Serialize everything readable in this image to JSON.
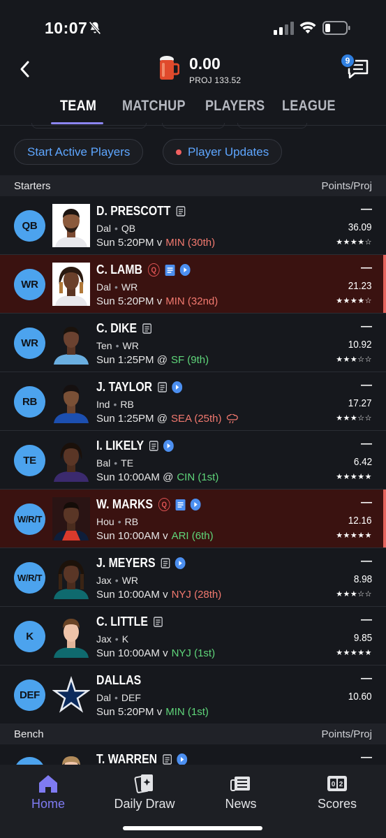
{
  "status_bar": {
    "time": "10:07"
  },
  "header": {
    "score": "0.00",
    "proj": "PROJ 133.52",
    "chat_badge": "9"
  },
  "tabs": [
    {
      "label": "TEAM",
      "active": true
    },
    {
      "label": "MATCHUP",
      "active": false
    },
    {
      "label": "PLAYERS",
      "active": false
    },
    {
      "label": "LEAGUE",
      "active": false
    }
  ],
  "actions": {
    "start_active": "Start Active Players",
    "player_updates": "Player Updates"
  },
  "starters": {
    "title": "Starters",
    "column": "Points/Proj",
    "rows": [
      {
        "pos": "QB",
        "name": "D. PRESCOTT",
        "team": "Dal",
        "position": "QB",
        "time": "Sun 5:20PM",
        "loc": "v",
        "opp": "MIN (30th)",
        "opp_quality": "bad",
        "points": "—",
        "proj": "36.09",
        "stars": "★★★★☆"
      },
      {
        "pos": "WR",
        "name": "C. LAMB",
        "team": "Dal",
        "position": "WR",
        "time": "Sun 5:20PM",
        "loc": "v",
        "opp": "MIN (32nd)",
        "opp_quality": "bad",
        "points": "—",
        "proj": "21.23",
        "stars": "★★★★☆",
        "questionable": "Q"
      },
      {
        "pos": "WR",
        "name": "C. DIKE",
        "team": "Ten",
        "position": "WR",
        "time": "Sun 1:25PM",
        "loc": "@",
        "opp": "SF (9th)",
        "opp_quality": "good",
        "points": "—",
        "proj": "10.92",
        "stars": "★★★☆☆"
      },
      {
        "pos": "RB",
        "name": "J. TAYLOR",
        "team": "Ind",
        "position": "RB",
        "time": "Sun 1:25PM",
        "loc": "@",
        "opp": "SEA (25th)",
        "opp_quality": "bad",
        "points": "—",
        "proj": "17.27",
        "stars": "★★★☆☆"
      },
      {
        "pos": "TE",
        "name": "I. LIKELY",
        "team": "Bal",
        "position": "TE",
        "time": "Sun 10:00AM",
        "loc": "@",
        "opp": "CIN (1st)",
        "opp_quality": "good",
        "points": "—",
        "proj": "6.42",
        "stars": "★★★★★"
      },
      {
        "pos": "W/R/T",
        "name": "W. MARKS",
        "team": "Hou",
        "position": "RB",
        "time": "Sun 10:00AM",
        "loc": "v",
        "opp": "ARI (6th)",
        "opp_quality": "good",
        "points": "—",
        "proj": "12.16",
        "stars": "★★★★★",
        "questionable": "Q"
      },
      {
        "pos": "W/R/T",
        "name": "J. MEYERS",
        "team": "Jax",
        "position": "WR",
        "time": "Sun 10:00AM",
        "loc": "v",
        "opp": "NYJ (28th)",
        "opp_quality": "bad",
        "points": "—",
        "proj": "8.98",
        "stars": "★★★☆☆"
      },
      {
        "pos": "K",
        "name": "C. LITTLE",
        "team": "Jax",
        "position": "K",
        "time": "Sun 10:00AM",
        "loc": "v",
        "opp": "NYJ (1st)",
        "opp_quality": "good",
        "points": "—",
        "proj": "9.85",
        "stars": "★★★★★"
      },
      {
        "pos": "DEF",
        "name": "DALLAS",
        "team": "Dal",
        "position": "DEF",
        "time": "Sun 5:20PM",
        "loc": "v",
        "opp": "MIN (1st)",
        "opp_quality": "good",
        "points": "—",
        "proj": "10.60",
        "stars": ""
      }
    ]
  },
  "bench": {
    "title": "Bench",
    "column": "Points/Proj",
    "first": {
      "name": "T. WARREN",
      "points": "—"
    }
  },
  "bottom_nav": [
    {
      "label": "Home",
      "active": true
    },
    {
      "label": "Daily Draw",
      "active": false
    },
    {
      "label": "News",
      "active": false
    },
    {
      "label": "Scores",
      "active": false
    }
  ],
  "colors": {
    "accent": "#7f7bf2",
    "position_badge": "#4ca3ee",
    "link": "#5ea6ff",
    "alert_row": "#3a1210",
    "bad_matchup": "#f2796f",
    "good_matchup": "#5fd67a"
  }
}
